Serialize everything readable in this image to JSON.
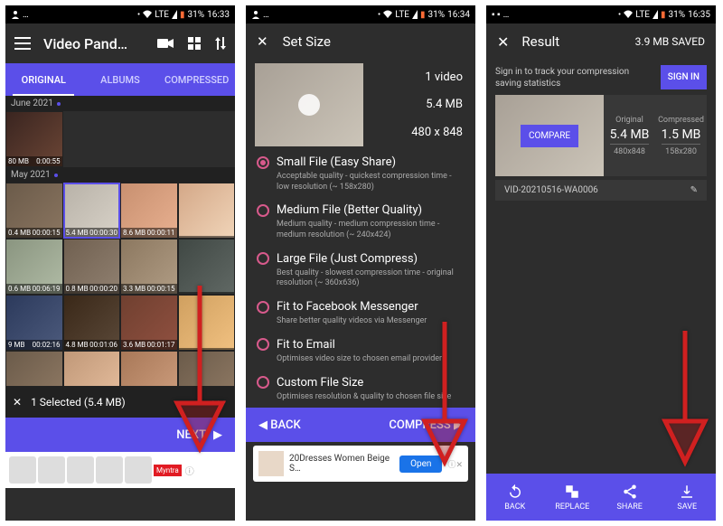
{
  "status": {
    "battery_text": "31%",
    "net_label": "LTE",
    "times": [
      "16:33",
      "16:34",
      "16:35"
    ]
  },
  "screen1": {
    "title": "Video Pand…",
    "tabs": {
      "original": "ORIGINAL",
      "albums": "ALBUMS",
      "compressed": "COMPRESSED"
    },
    "sections": {
      "june": "June 2021",
      "may": "May 2021"
    },
    "thumbs_june": [
      {
        "size": "80 MB",
        "time": "0:00:55"
      }
    ],
    "thumbs_may": [
      [
        {
          "size": "0.4 MB",
          "time": "00:00:15"
        },
        {
          "size": "5.4 MB",
          "time": "00:00:30"
        },
        {
          "size": "8.6 MB",
          "time": "00:00:11"
        },
        {
          "size": "",
          "time": ""
        }
      ],
      [
        {
          "size": "0.6 MB",
          "time": "00:06:19"
        },
        {
          "size": "0.8 MB",
          "time": "00:00:20"
        },
        {
          "size": "3.3 MB",
          "time": "00:00:15"
        },
        {
          "size": "",
          "time": ""
        }
      ],
      [
        {
          "size": "9 MB",
          "time": "00:02:16"
        },
        {
          "size": "4.8 MB",
          "time": "00:01:06"
        },
        {
          "size": "3.6 MB",
          "time": "00:01:17"
        },
        {
          "size": "",
          "time": ""
        }
      ]
    ],
    "selected": "1 Selected (5.4 MB)",
    "next": "NEXT"
  },
  "screen2": {
    "title": "Set Size",
    "stats": {
      "count": "1 video",
      "size": "5.4 MB",
      "dims": "480 x 848"
    },
    "options": [
      {
        "label": "Small File (Easy Share)",
        "desc": "Acceptable quality - quickest compression time - low resolution (~ 158x280)",
        "selected": true
      },
      {
        "label": "Medium File (Better Quality)",
        "desc": "Medium quality - medium compression time - medium resolution (~ 240x424)",
        "selected": false
      },
      {
        "label": "Large File (Just Compress)",
        "desc": "Best quality - slowest compression time - original resolution (~ 360x636)",
        "selected": false
      },
      {
        "label": "Fit to Facebook Messenger",
        "desc": "Share better quality videos via Messenger",
        "selected": false
      },
      {
        "label": "Fit to Email",
        "desc": "Optimises video size to chosen email provider",
        "selected": false
      },
      {
        "label": "Custom File Size",
        "desc": "Optimises resolution & quality to chosen file size",
        "selected": false
      }
    ],
    "back": "BACK",
    "compress": "COMPRESS",
    "ad": {
      "text": "20Dresses Women Beige S…",
      "cta": "Open"
    }
  },
  "screen3": {
    "title": "Result",
    "saved": "3.9 MB SAVED",
    "signin_msg": "Sign in to track your compression saving statistics",
    "signin": "SIGN IN",
    "compare": "COMPARE",
    "table": {
      "orig_label": "Original",
      "comp_label": "Compressed",
      "orig_size": "5.4 MB",
      "comp_size": "1.5 MB",
      "orig_dims": "480x848",
      "comp_dims": "158x280"
    },
    "filename": "VID-20210516-WA0006",
    "nav": {
      "back": "BACK",
      "replace": "REPLACE",
      "share": "SHARE",
      "save": "SAVE"
    }
  }
}
